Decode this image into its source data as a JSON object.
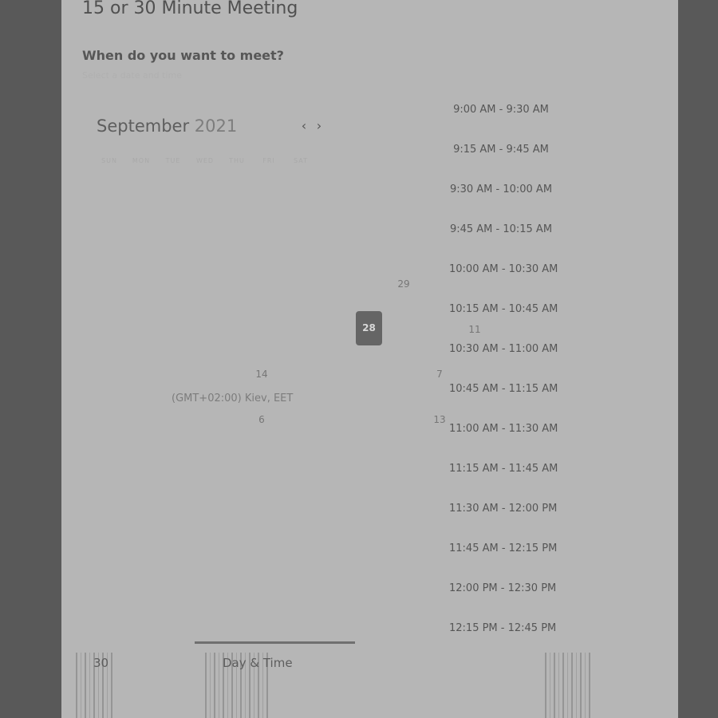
{
  "header": {
    "title": "15 or 30 Minute Meeting",
    "question": "When do you want to meet?",
    "subtitle": "Select a date and time"
  },
  "calendar": {
    "month": "September",
    "year": "2021",
    "prev_icon": "chevron-left-icon",
    "next_icon": "chevron-right-icon",
    "weekdays": [
      "SUN",
      "MON",
      "TUE",
      "WED",
      "THU",
      "FRI",
      "SAT"
    ],
    "visible_days": [
      "29",
      "28",
      "11",
      "14",
      "7",
      "6",
      "13"
    ],
    "selected_day": "28",
    "timezone": "(GMT+02:00) Kiev, EET"
  },
  "time_slots": [
    "9:00 AM - 9:30 AM",
    "9:15 AM - 9:45 AM",
    "9:30 AM - 10:00 AM",
    "9:45 AM - 10:15 AM",
    "10:00 AM - 10:30 AM",
    "10:15 AM - 10:45 AM",
    "10:30 AM - 11:00 AM",
    "10:45 AM - 11:15 AM",
    "11:00 AM - 11:30 AM",
    "11:15 AM - 11:45 AM",
    "11:30 AM - 12:00 PM",
    "11:45 AM - 12:15 PM",
    "12:00 PM - 12:30 PM",
    "12:15 PM - 12:45 PM"
  ],
  "steps": {
    "step1_label": "30",
    "step2_label": "Day & Time"
  },
  "colors": {
    "overlay": "#595959",
    "card": "#b6b6b6",
    "selected": "#656565"
  }
}
